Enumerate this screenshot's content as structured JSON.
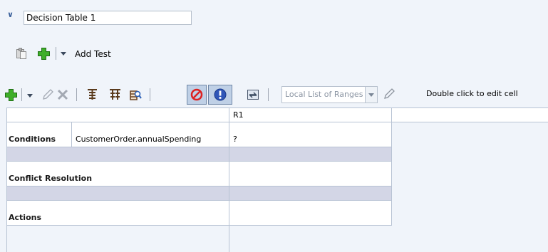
{
  "decision_table": {
    "name": "Decision Table 1"
  },
  "test_toolbar": {
    "add_test_label": "Add Test"
  },
  "table_toolbar": {
    "range_select_value": "Local List of Ranges",
    "hint": "Double click to edit cell"
  },
  "table": {
    "rule_header": "R1",
    "conditions_label": "Conditions",
    "condition_expression": "CustomerOrder.annualSpending",
    "condition_value": "?",
    "conflict_label": "Conflict Resolution",
    "actions_label": "Actions"
  },
  "colors": {
    "background": "#f0f4fa",
    "grid_line": "#b8c3d4",
    "band": "#d3d6e6",
    "active_button": "#bfd0e6"
  }
}
